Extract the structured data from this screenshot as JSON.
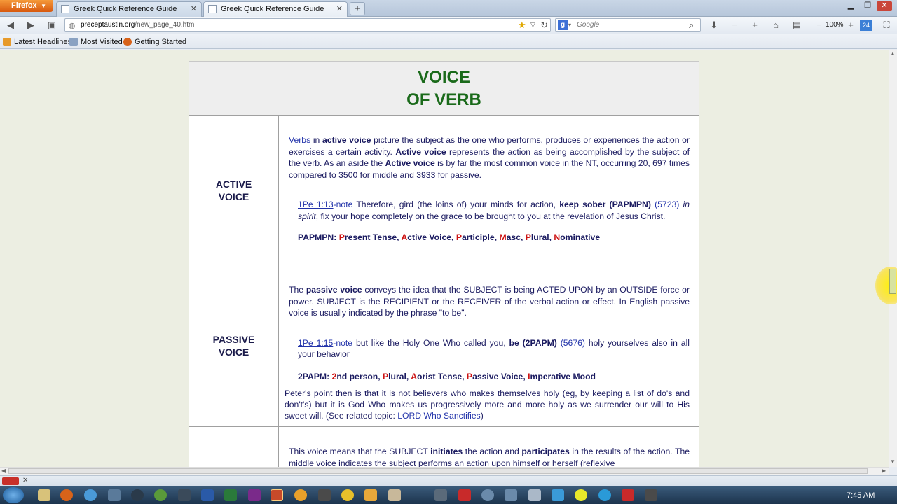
{
  "browser": {
    "app_button": "Firefox",
    "tabs": [
      {
        "title": "Greek Quick Reference Guide"
      },
      {
        "title": "Greek Quick Reference Guide"
      }
    ],
    "url_domain": "preceptaustin.org",
    "url_path": "/new_page_40.htm",
    "search_placeholder": "Google",
    "zoom_level": "100%",
    "bookmarks": [
      "Latest Headlines",
      "Most Visited",
      "Getting Started"
    ]
  },
  "page": {
    "title_line1": "VOICE",
    "title_line2": "OF VERB",
    "active": {
      "label_line1": "ACTIVE",
      "label_line2": "VOICE",
      "p1_a": "Verbs",
      "p1_b": " in ",
      "p1_c": "active voice",
      "p1_d": " picture the subject as the one who performs, produces or experiences the action or exercises a certain activity. ",
      "p1_e": "Active voice",
      "p1_f": " represents the action as being accomplished by the subject of the verb. As an aside the ",
      "p1_g": "Active voice",
      "p1_h": " is by far the most common voice in the NT, occurring 20, 697 times compared to 3500 for middle and 3933 for passive.",
      "ref_link": "1Pe 1:13",
      "ref_note": "-note",
      "ref_text1": "  Therefore, gird (the loins of) your minds for action, ",
      "ref_bold": "keep sober",
      "ref_code": " (PAPMPN)",
      "ref_num": " (5723)",
      "ref_italic": " in spirit",
      "ref_text2": ", fix your hope completely on the grace to be brought to you at the revelation of Jesus Christ.",
      "parse_code": "PAPMPN",
      "parse_colon": ": ",
      "parse_parts": [
        {
          "letter": "P",
          "rest": "resent Tense, "
        },
        {
          "letter": "A",
          "rest": "ctive Voice, "
        },
        {
          "letter": "P",
          "rest": "articiple, "
        },
        {
          "letter": "M",
          "rest": "asc, "
        },
        {
          "letter": "P",
          "rest": "lural, "
        },
        {
          "letter": "N",
          "rest": "ominative"
        }
      ]
    },
    "passive": {
      "label_line1": "PASSIVE",
      "label_line2": "VOICE",
      "p1_a": "The ",
      "p1_b": "passive voice",
      "p1_c": " conveys the idea that the SUBJECT is being ACTED UPON by an OUTSIDE force or power. SUBJECT is the RECIPIENT or the RECEIVER of the verbal action or effect.  In English passive voice is usually indicated by the phrase \"to be\".",
      "ref_link": "1Pe 1:15",
      "ref_note": "-note",
      "ref_text1": " but like the Holy One Who called you, ",
      "ref_red": "be",
      "ref_code": " (2PAPM)",
      "ref_num": " (5676)",
      "ref_text2": " holy yourselves also in all your behavior",
      "parse_code": "2PAPM",
      "parse_colon": ": ",
      "parse_parts": [
        {
          "letter": "2",
          "rest": "nd person, "
        },
        {
          "letter": "P",
          "rest": "lural, "
        },
        {
          "letter": "A",
          "rest": "orist Tense, "
        },
        {
          "letter": "P",
          "rest": "assive Voice, "
        },
        {
          "letter": "I",
          "rest": "mperative Mood"
        }
      ],
      "p3_a": "Peter's point then is that it is not believers who makes themselves holy (eg, by keeping a list of do's and don't's) but it is God Who makes us progressively more and more holy as we surrender our will to His sweet will. (See related topic: ",
      "p3_link": "LORD Who Sanctifies",
      "p3_b": ")"
    },
    "middle": {
      "p1_a": "This voice means that the SUBJECT ",
      "p1_b": "initiates",
      "p1_c": " the action and ",
      "p1_d": "participates",
      "p1_e": " in the results of the action. The middle voice indicates the subject performs an action upon himself or herself (reflexive"
    }
  },
  "taskbar": {
    "clock": "7:45 AM"
  }
}
